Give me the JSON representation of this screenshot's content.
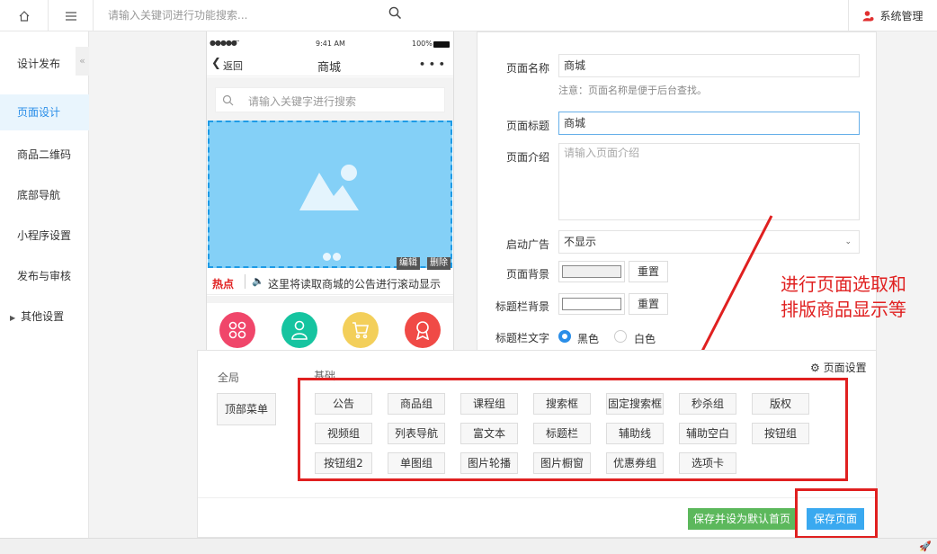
{
  "topbar": {
    "search_placeholder": "请输入关键词进行功能搜索...",
    "system_label": "系统管理"
  },
  "sidebar": {
    "title": "设计发布",
    "items": [
      {
        "label": "页面设计"
      },
      {
        "label": "商品二维码"
      },
      {
        "label": "底部导航"
      },
      {
        "label": "小程序设置"
      },
      {
        "label": "发布与审核"
      },
      {
        "label": "其他设置"
      }
    ]
  },
  "phone": {
    "status_time": "9:41 AM",
    "status_battery": "100%",
    "back_label": "返回",
    "title": "商城",
    "more": "• • •",
    "search_placeholder": "请输入关键字进行搜索",
    "banner_edit": "编辑",
    "banner_delete": "删除",
    "notice_tag": "热点",
    "notice_text": "这里将读取商城的公告进行滚动显示"
  },
  "form": {
    "name_label": "页面名称",
    "name_value": "商城",
    "name_hint": "注意：页面名称是便于后台查找。",
    "title_label": "页面标题",
    "title_value": "商城",
    "intro_label": "页面介绍",
    "intro_placeholder": "请输入页面介绍",
    "ad_label": "启动广告",
    "ad_value": "不显示",
    "bg_label": "页面背景",
    "reset1": "重置",
    "titlebg_label": "标题栏背景",
    "reset2": "重置",
    "titletext_label": "标题栏文字",
    "black": "黑色",
    "white": "白色"
  },
  "annotation": {
    "line1": "进行页面选取和",
    "line2": "排版商品显示等"
  },
  "panel": {
    "global_label": "全局",
    "basic_label": "基础",
    "top_menu": "顶部菜单",
    "page_settings": "页面设置",
    "components": [
      "公告",
      "商品组",
      "课程组",
      "搜索框",
      "固定搜索框",
      "秒杀组",
      "版权",
      "视频组",
      "列表导航",
      "富文本",
      "标题栏",
      "辅助线",
      "辅助空白",
      "按钮组",
      "按钮组2",
      "单图组",
      "图片轮播",
      "图片橱窗",
      "优惠券组",
      "选项卡"
    ],
    "save_default": "保存并设为默认首页",
    "save": "保存页面"
  },
  "colors": {
    "accent": "#2a8ee8",
    "annotation_red": "#e02020",
    "save_green": "#5cb85c",
    "save_blue": "#3aa9f0"
  }
}
